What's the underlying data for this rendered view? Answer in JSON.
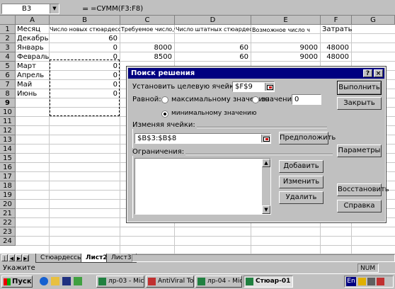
{
  "formula_bar": {
    "cell_ref": "B3",
    "equals": "=",
    "formula": "=СУММ(F3:F8)"
  },
  "columns": [
    "A",
    "B",
    "C",
    "D",
    "E",
    "F",
    "G"
  ],
  "rows": [
    "1",
    "2",
    "3",
    "4",
    "5",
    "6",
    "7",
    "8",
    "9",
    "10",
    "11",
    "12",
    "13",
    "14",
    "15",
    "16",
    "17",
    "18",
    "19",
    "20",
    "21",
    "22",
    "23",
    "24"
  ],
  "headers_row1": {
    "A": "Месяц",
    "B": "Число новых стюардесс",
    "C": "Требуемое число,ч",
    "D": "Число штатных стюардесс",
    "E": "Возможное число ч",
    "F": "Затраты"
  },
  "months": [
    "Декабрь",
    "Январь",
    "Февраль",
    "Март",
    "Апрель",
    "Май",
    "Июнь"
  ],
  "col_b": [
    "60",
    "0",
    "0",
    "0",
    "0",
    "0",
    "0"
  ],
  "col_c": [
    "",
    "8000",
    "8500",
    "",
    "",
    "",
    ""
  ],
  "col_d": [
    "",
    "60",
    "60",
    "",
    "",
    "",
    ""
  ],
  "col_e": [
    "",
    "9000",
    "9000",
    "",
    "",
    "",
    ""
  ],
  "col_f": [
    "",
    "48000",
    "48000",
    "",
    "",
    "",
    ""
  ],
  "sheet_tabs": [
    "Стюардессы",
    "Лист2",
    "Лист3"
  ],
  "active_tab": "Лист2",
  "status": {
    "text": "Укажите",
    "num": "NUM"
  },
  "taskbar": {
    "start": "Пуск",
    "buttons": [
      "лр-03 - Micr...",
      "AntiViral To...",
      "лр-04 - Micr...",
      "Стюар-01"
    ],
    "lang": "En"
  },
  "solver": {
    "title": "Поиск решения",
    "help_btn": "?",
    "close_btn": "×",
    "target_label": "Установить целевую ячейку:",
    "target_value": "$F$9",
    "equal_label": "Равной:",
    "opt_max": "максимальному значению",
    "opt_value": "значению:",
    "value_field": "0",
    "opt_min": "минимальному значению",
    "changing_label": "Изменяя ячейки:",
    "changing_value": "$B$3:$B$8",
    "constraints_label": "Ограничения:",
    "btn_execute": "Выполнить",
    "btn_close": "Закрыть",
    "btn_guess": "Предположить",
    "btn_params": "Параметры",
    "btn_add": "Добавить",
    "btn_change": "Изменить",
    "btn_delete": "Удалить",
    "btn_reset": "Восстановить",
    "btn_help": "Справка"
  }
}
